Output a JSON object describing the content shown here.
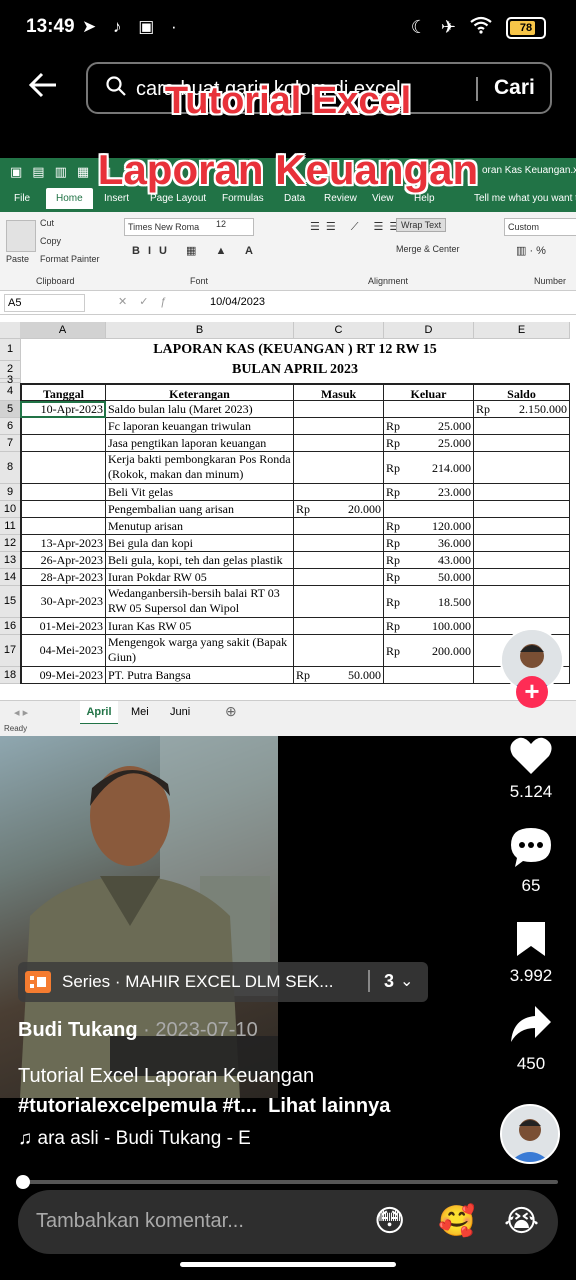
{
  "status": {
    "time": "13:49",
    "battery": "78",
    "battery_fraction": 0.78
  },
  "search": {
    "query": "cara buat garis kolom di excel",
    "submit_label": "Cari"
  },
  "overlay": {
    "line1": "Tutorial Excel",
    "line2": "Laporan Keuangan"
  },
  "excel": {
    "title_fragment": "oran Kas Keuangan.x",
    "tabs": [
      "File",
      "Home",
      "Insert",
      "Page Layout",
      "Formulas",
      "Data",
      "Review",
      "View",
      "Help"
    ],
    "tell_me": "Tell me what you want t",
    "clipboard": {
      "cut": "Cut",
      "copy": "Copy",
      "format_painter": "Format Painter",
      "paste": "Paste",
      "group": "Clipboard"
    },
    "font": {
      "name": "Times New Roma",
      "size": "12",
      "group": "Font"
    },
    "alignment": {
      "wrap": "Wrap Text",
      "merge": "Merge & Center",
      "group": "Alignment"
    },
    "number": {
      "format": "Custom",
      "group": "Number"
    },
    "name_box": "A5",
    "formula": "10/04/2023",
    "columns": [
      "A",
      "B",
      "C",
      "D",
      "E"
    ],
    "title1": "LAPORAN KAS (KEUANGAN ) RT 12 RW 15",
    "title2": "BULAN  APRIL 2023",
    "headers": [
      "Tanggal",
      "Keterangan",
      "Masuk",
      "Keluar",
      "Saldo"
    ],
    "rows": [
      {
        "n": "5",
        "date": "10-Apr-2023",
        "desc": "Saldo bulan lalu  (Maret 2023)",
        "in_rp": "",
        "in": "",
        "out_rp": "",
        "out": "",
        "bal_rp": "Rp",
        "bal": "2.150.000"
      },
      {
        "n": "6",
        "date": "",
        "desc": "Fc laporan keuangan triwulan",
        "in_rp": "",
        "in": "",
        "out_rp": "Rp",
        "out": "25.000",
        "bal_rp": "",
        "bal": ""
      },
      {
        "n": "7",
        "date": "",
        "desc": "Jasa pengtikan laporan keuangan",
        "in_rp": "",
        "in": "",
        "out_rp": "Rp",
        "out": "25.000",
        "bal_rp": "",
        "bal": ""
      },
      {
        "n": "8",
        "date": "",
        "desc": "Kerja bakti pembongkaran Pos Ronda (Rokok, makan dan minum)",
        "in_rp": "",
        "in": "",
        "out_rp": "Rp",
        "out": "214.000",
        "bal_rp": "",
        "bal": ""
      },
      {
        "n": "9",
        "date": "",
        "desc": "Beli Vit gelas",
        "in_rp": "",
        "in": "",
        "out_rp": "Rp",
        "out": "23.000",
        "bal_rp": "",
        "bal": ""
      },
      {
        "n": "10",
        "date": "",
        "desc": "Pengembalian uang arisan",
        "in_rp": "Rp",
        "in": "20.000",
        "out_rp": "",
        "out": "",
        "bal_rp": "",
        "bal": ""
      },
      {
        "n": "11",
        "date": "",
        "desc": "Menutup arisan",
        "in_rp": "",
        "in": "",
        "out_rp": "Rp",
        "out": "120.000",
        "bal_rp": "",
        "bal": ""
      },
      {
        "n": "12",
        "date": "13-Apr-2023",
        "desc": "Bei gula dan kopi",
        "in_rp": "",
        "in": "",
        "out_rp": "Rp",
        "out": "36.000",
        "bal_rp": "",
        "bal": ""
      },
      {
        "n": "13",
        "date": "26-Apr-2023",
        "desc": "Beli gula, kopi, teh dan gelas plastik",
        "in_rp": "",
        "in": "",
        "out_rp": "Rp",
        "out": "43.000",
        "bal_rp": "",
        "bal": ""
      },
      {
        "n": "14",
        "date": "28-Apr-2023",
        "desc": "Iuran Pokdar RW 05",
        "in_rp": "",
        "in": "",
        "out_rp": "Rp",
        "out": "50.000",
        "bal_rp": "",
        "bal": ""
      },
      {
        "n": "15",
        "date": "30-Apr-2023",
        "desc": "Wedanganbersih-bersih balai RT 03 RW 05 Supersol dan Wipol",
        "in_rp": "",
        "in": "",
        "out_rp": "Rp",
        "out": "18.500",
        "bal_rp": "",
        "bal": ""
      },
      {
        "n": "16",
        "date": "01-Mei-2023",
        "desc": "Iuran Kas RW 05",
        "in_rp": "",
        "in": "",
        "out_rp": "Rp",
        "out": "100.000",
        "bal_rp": "",
        "bal": ""
      },
      {
        "n": "17",
        "date": "04-Mei-2023",
        "desc": "Mengengok warga yang sakit (Bapak Giun)",
        "in_rp": "",
        "in": "",
        "out_rp": "Rp",
        "out": "200.000",
        "bal_rp": "",
        "bal": ""
      },
      {
        "n": "18",
        "date": "09-Mei-2023",
        "desc": "PT. Putra Bangsa",
        "in_rp": "Rp",
        "in": "50.000",
        "out_rp": "",
        "out": "",
        "bal_rp": "",
        "bal": ""
      }
    ],
    "sheet_tabs": [
      "April",
      "Mei",
      "Juni"
    ],
    "status": "Ready"
  },
  "actions": {
    "likes": "5.124",
    "comments": "65",
    "saves": "3.992",
    "shares": "450"
  },
  "series": {
    "label": "Series · MAHIR EXCEL DLM SEK...",
    "count": "3"
  },
  "post": {
    "author": "Budi Tukang",
    "date": " · 2023-07-10",
    "description": "Tutorial Excel Laporan  Keuangan",
    "hashtags": "#tutorialexcelpemula #t...",
    "more": "Lihat lainnya",
    "music": "ara asli - Budi Tukang - E"
  },
  "comment_input": {
    "placeholder": "Tambahkan komentar..."
  },
  "emojis": [
    "😳",
    "🥰",
    "😭"
  ],
  "progress_fraction": 0.01
}
